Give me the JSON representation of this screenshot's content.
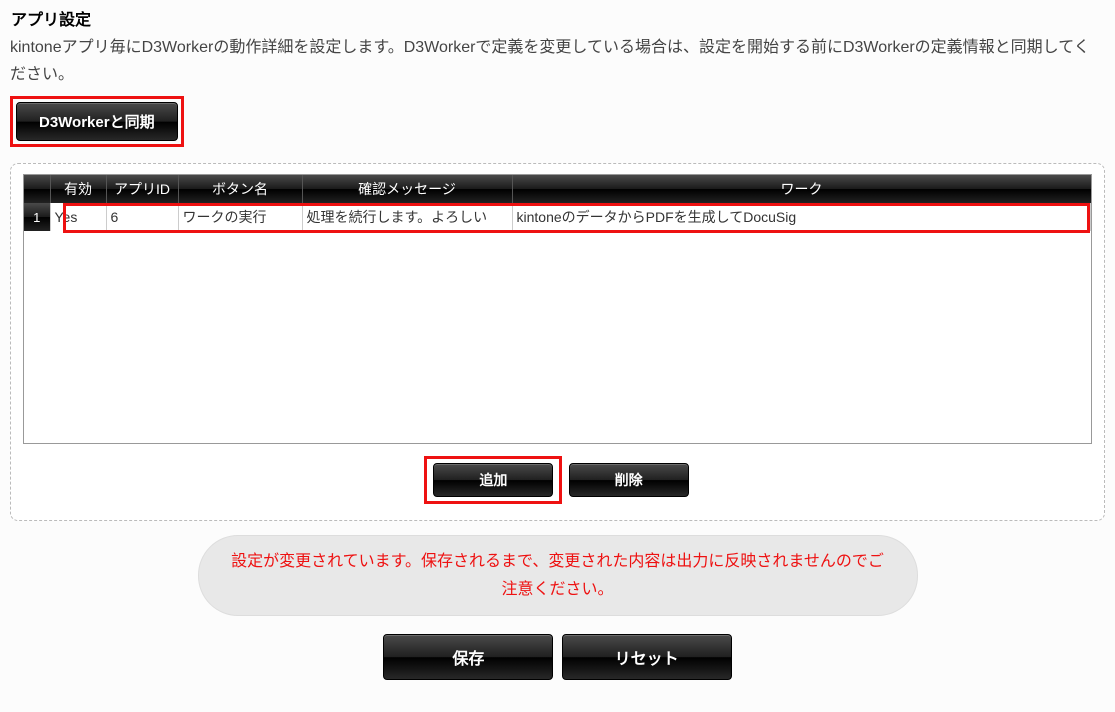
{
  "header": {
    "title": "アプリ設定",
    "description": "kintoneアプリ毎にD3Workerの動作詳細を設定します。D3Workerで定義を変更している場合は、設定を開始する前にD3Workerの定義情報と同期してください。"
  },
  "buttons": {
    "sync": "D3Workerと同期",
    "add": "追加",
    "delete": "削除",
    "save": "保存",
    "reset": "リセット"
  },
  "table": {
    "headers": {
      "rownum": "",
      "enabled": "有効",
      "appid": "アプリID",
      "button": "ボタン名",
      "confirm": "確認メッセージ",
      "work": "ワーク"
    },
    "rows": [
      {
        "rownum": "1",
        "enabled": "Yes",
        "appid": "6",
        "button": "ワークの実行",
        "confirm": "処理を続行します。よろしい",
        "work": "kintoneのデータからPDFを生成してDocuSig"
      }
    ]
  },
  "status": {
    "message": "設定が変更されています。保存されるまで、変更された内容は出力に反映されませんのでご注意ください。"
  }
}
